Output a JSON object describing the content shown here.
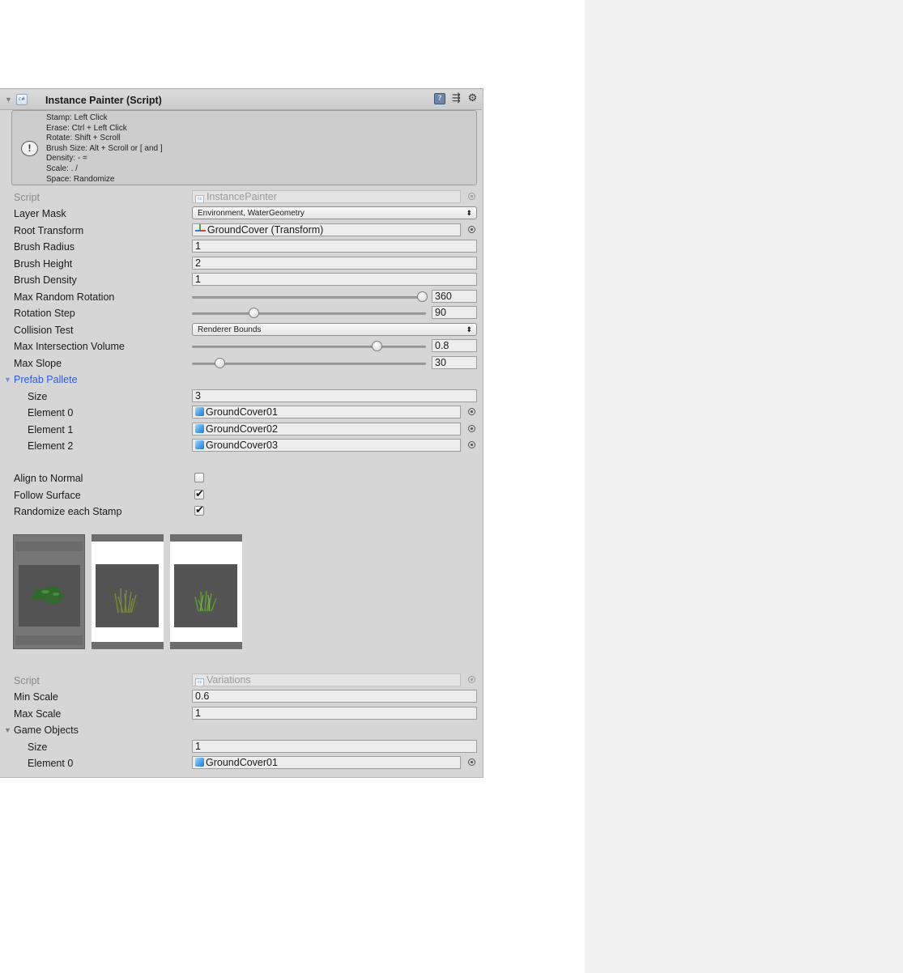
{
  "component": {
    "title": "Instance Painter (Script)",
    "icon": "cs-script-icon",
    "header_icons": [
      "help-book-icon",
      "preset-sliders-icon",
      "gear-menu-icon"
    ]
  },
  "help": {
    "icon": "info-exclamation-icon",
    "lines": [
      "Stamp: Left Click",
      "Erase: Ctrl + Left Click",
      "Rotate: Shift + Scroll",
      "Brush Size: Alt + Scroll or [ and ]",
      "Density: - =",
      "Scale: . /",
      "Space: Randomize"
    ]
  },
  "painter": {
    "script_label": "Script",
    "script_value": "InstancePainter",
    "layer_mask_label": "Layer Mask",
    "layer_mask_value": "Environment, WaterGeometry",
    "root_transform_label": "Root Transform",
    "root_transform_value": "GroundCover (Transform)",
    "brush_radius_label": "Brush Radius",
    "brush_radius_value": "1",
    "brush_height_label": "Brush Height",
    "brush_height_value": "2",
    "brush_density_label": "Brush Density",
    "brush_density_value": "1",
    "max_random_rotation_label": "Max Random Rotation",
    "max_random_rotation_value": "360",
    "rotation_step_label": "Rotation Step",
    "rotation_step_value": "90",
    "collision_test_label": "Collision Test",
    "collision_test_value": "Renderer Bounds",
    "max_intersection_label": "Max Intersection Volume",
    "max_intersection_value": "0.8",
    "max_slope_label": "Max Slope",
    "max_slope_value": "30",
    "prefab_pallete_label": "Prefab Pallete",
    "size_label": "Size",
    "size_value": "3",
    "elements": [
      {
        "label": "Element 0",
        "value": "GroundCover01"
      },
      {
        "label": "Element 1",
        "value": "GroundCover02"
      },
      {
        "label": "Element 2",
        "value": "GroundCover03"
      }
    ],
    "align_label": "Align to Normal",
    "align_checked": false,
    "follow_label": "Follow Surface",
    "follow_checked": true,
    "randomize_label": "Randomize each Stamp",
    "randomize_checked": true,
    "check_glyph": "✔",
    "sliders": {
      "max_random_rotation_fraction": 1.0,
      "rotation_step_fraction": 0.25,
      "max_intersection_fraction": 0.8,
      "max_slope_fraction": 0.1
    },
    "previews": [
      {
        "name": "GroundCover01",
        "selected": true,
        "plant_color": "#2e6b2a"
      },
      {
        "name": "GroundCover02",
        "selected": false,
        "plant_color": "#7a8a3c"
      },
      {
        "name": "GroundCover03",
        "selected": false,
        "plant_color": "#5e9a34"
      }
    ]
  },
  "variations": {
    "script_label": "Script",
    "script_value": "Variations",
    "min_scale_label": "Min Scale",
    "min_scale_value": "0.6",
    "max_scale_label": "Max Scale",
    "max_scale_value": "1",
    "game_objects_label": "Game Objects",
    "size_label": "Size",
    "size_value": "1",
    "element0_label": "Element 0",
    "element0_value": "GroundCover01"
  }
}
